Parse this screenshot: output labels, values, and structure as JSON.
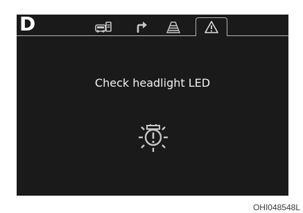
{
  "cluster": {
    "gear": "D",
    "tabs": [
      {
        "icon": "vehicle-info-icon",
        "active": false
      },
      {
        "icon": "turn-by-turn-arrow-icon",
        "active": false
      },
      {
        "icon": "lane-assist-icon",
        "active": false
      },
      {
        "icon": "warning-triangle-icon",
        "active": true
      }
    ],
    "message": "Check headlight LED",
    "warning_icon": "headlight-led-warning-icon",
    "colors": {
      "background": "#1a1a1a",
      "text": "#f2f2f2",
      "icon": "#c8c8c8",
      "tab_border": "#b4b4b4"
    }
  },
  "caption": "OHI048548L"
}
